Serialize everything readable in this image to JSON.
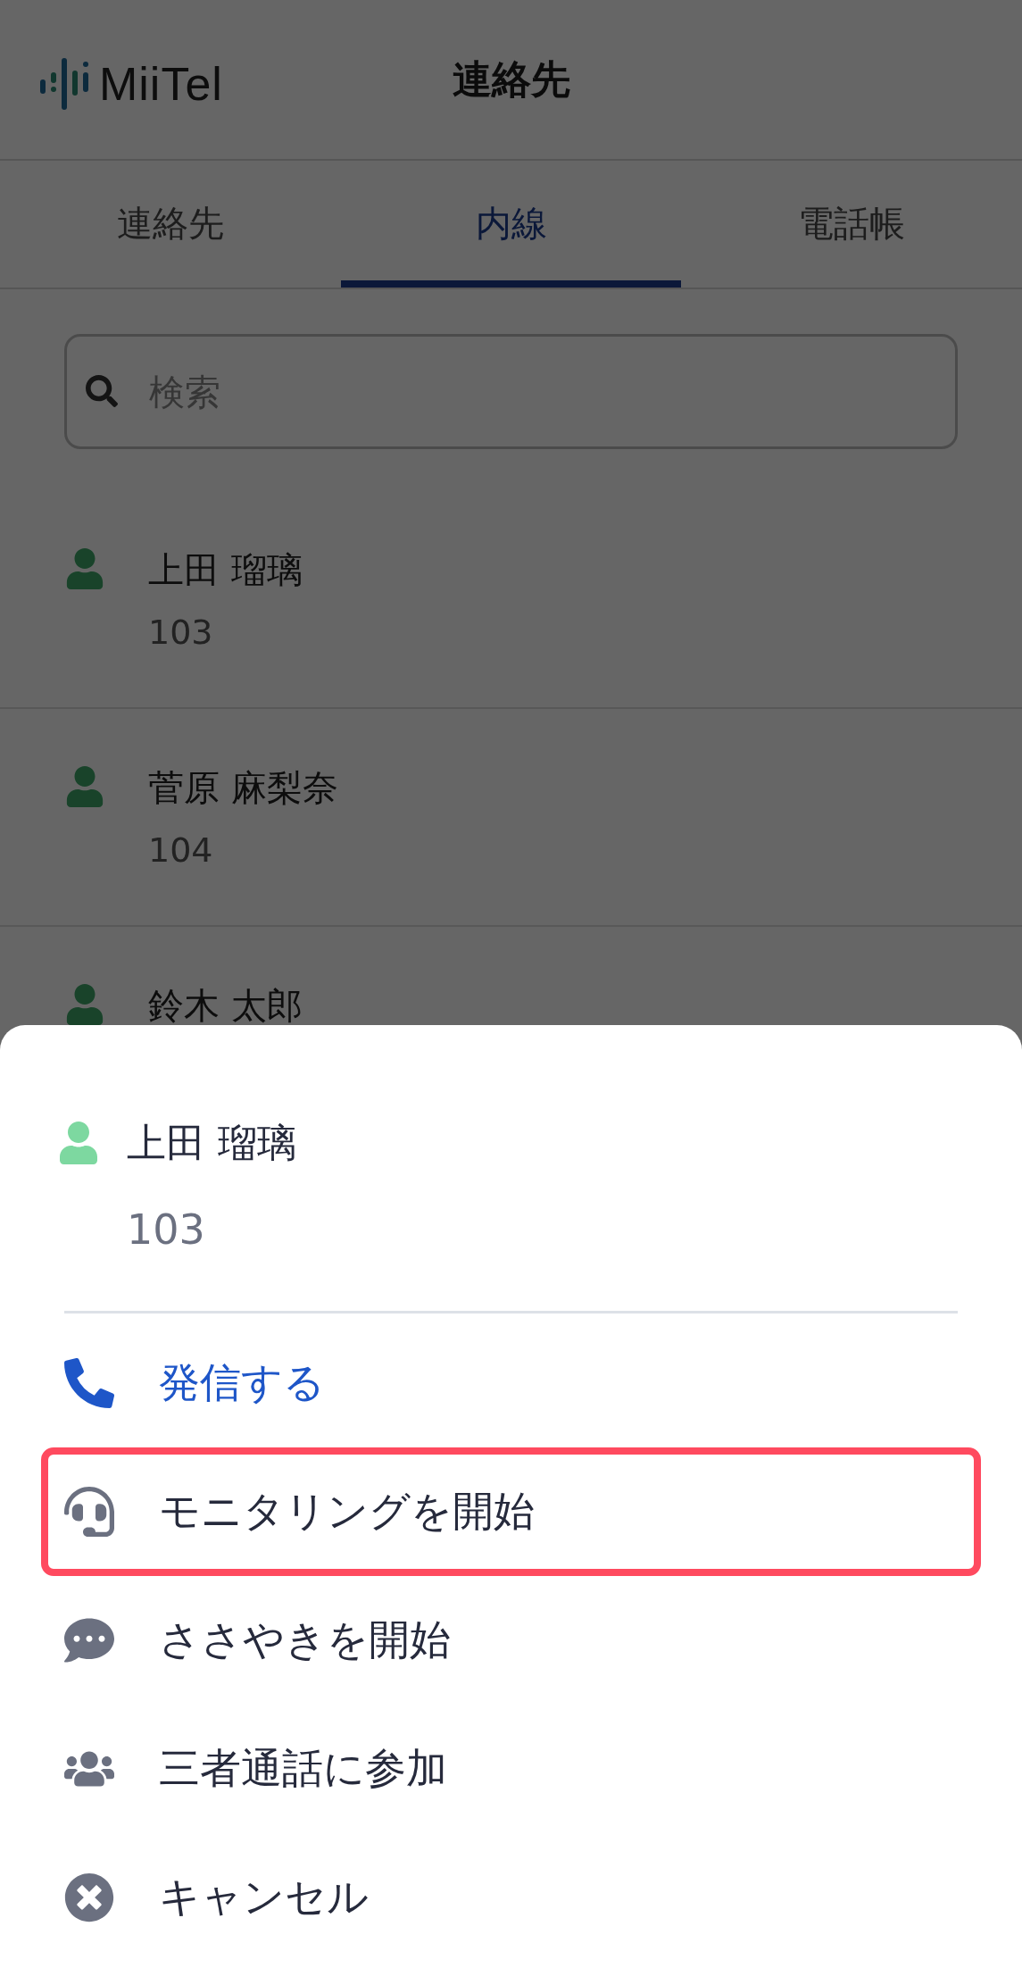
{
  "header": {
    "logo": "MiiTel",
    "title": "連絡先"
  },
  "tabs": [
    {
      "label": "連絡先",
      "selected": false
    },
    {
      "label": "内線",
      "selected": true
    },
    {
      "label": "電話帳",
      "selected": false
    }
  ],
  "search": {
    "placeholder": "検索"
  },
  "contacts": [
    {
      "name": "上田 瑠璃",
      "extension": "103"
    },
    {
      "name": "菅原 麻梨奈",
      "extension": "104"
    },
    {
      "name": "鈴木 太郎"
    }
  ],
  "sheet": {
    "contact": {
      "name": "上田 瑠璃",
      "extension": "103"
    },
    "actions": [
      {
        "kind": "call",
        "label": "発信する",
        "highlighted": false
      },
      {
        "kind": "monitor",
        "label": "モニタリングを開始",
        "highlighted": true
      },
      {
        "kind": "whisper",
        "label": "ささやきを開始",
        "highlighted": false
      },
      {
        "kind": "conference",
        "label": "三者通話に参加",
        "highlighted": false
      },
      {
        "kind": "cancel",
        "label": "キャンセル",
        "highlighted": false
      }
    ]
  }
}
